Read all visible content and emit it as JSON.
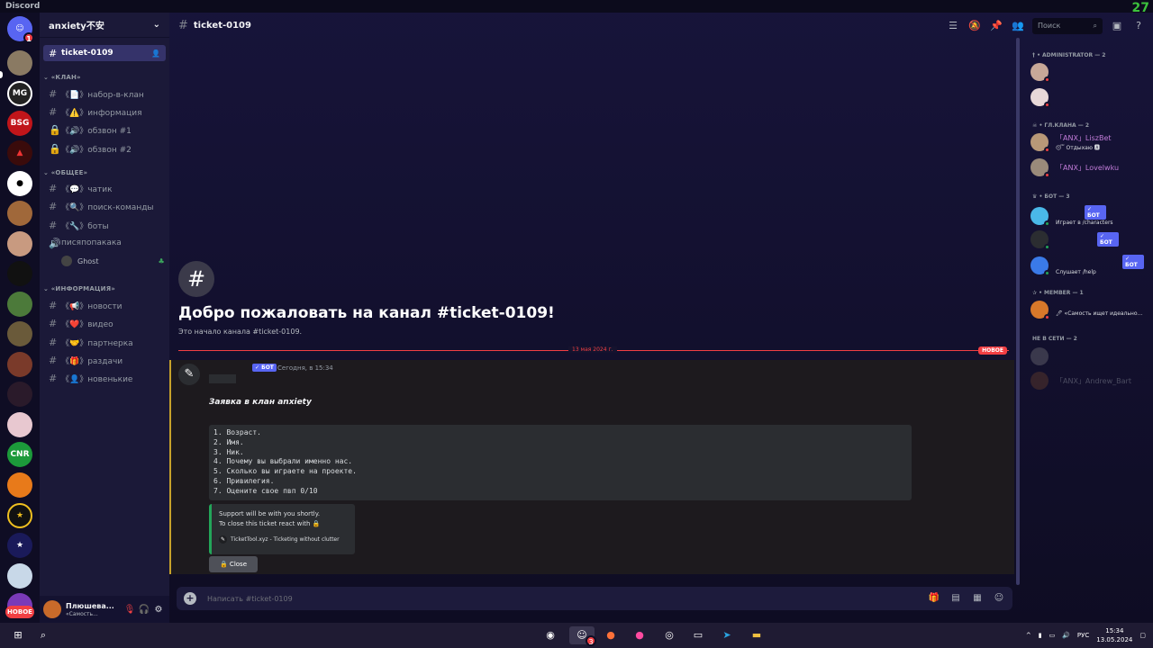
{
  "window": {
    "app_title": "Discord",
    "fps": "27"
  },
  "rail": {
    "home_badge": "1",
    "new_label": "НОВОЕ",
    "bsg_label": "BSG",
    "mg_label": "MG",
    "coin_label": "CNR"
  },
  "guild": {
    "name": "anxiety不安"
  },
  "channels": {
    "active": "ticket-0109",
    "cat_clan": "«КЛАН»",
    "nabor": "《📄》набор-в-клан",
    "info": "《⚠️》информация",
    "review1": "《🔊》обзвон #1",
    "review2": "《🔊》обзвон #2",
    "cat_general": "«ОБЩЕЕ»",
    "chat": "《💬》чатик",
    "search_team": "《🔍》поиск-команды",
    "bots": "《🔧》боты",
    "voice": "писяпопакака",
    "voice_user": "Ghost",
    "cat_info": "«ИНФОРМАЦИЯ»",
    "news": "《📢》новости",
    "video": "《❤️》видео",
    "partners": "《🤝》партнерка",
    "giveaways": "《🎁》раздачи",
    "newbies": "《👤》новенькие"
  },
  "user": {
    "name": "Плюшева...",
    "status": "«Самость..."
  },
  "header": {
    "channel": "ticket-0109",
    "search_placeholder": "Поиск"
  },
  "welcome": {
    "title": "Добро пожаловать на канал #ticket-0109!",
    "subtitle": "Это начало канала #ticket-0109."
  },
  "divider": {
    "date": "13 мая 2024 г.",
    "new_label": "НОВОЕ"
  },
  "message": {
    "bot_tag": "✓ БОТ",
    "time": "Сегодня, в 15:34",
    "title": "Заявка в клан anxiety",
    "lines": [
      "1. Возраст.",
      "2. Имя.",
      "3. Ник.",
      "4. Почему вы выбрали именно нас.",
      "5. Сколько вы играете на проекте.",
      "6. Привилегия.",
      "7. Оцените свое пвп 0/10"
    ],
    "embed_line1": "Support will be with you shortly.",
    "embed_line2": "To close this ticket react with 🔒",
    "embed_footer": "TicketTool.xyz - Ticketing without clutter",
    "close_button": "🔒 Close"
  },
  "composer": {
    "placeholder": "Написать #ticket-0109"
  },
  "members": {
    "admin_header": "† • ADMINISTRATOR — 2",
    "leader_header": "☠ • ГЛ.КЛАНА — 2",
    "leader1_name": "「ANX」LiszBet",
    "leader1_activity": "😴 Отдыхаю 🅰",
    "leader2_name": "「ANX」Lovelwku",
    "bot_header": "♛ • БОТ — 3",
    "bot1_activity": "Играет в /characters",
    "bot3_activity": "Слушает /help",
    "bot_tag": "✓ БОТ",
    "member_header": "✰ • MEMBER — 1",
    "member1_activity": "🖊 «Самость ищет идеально...",
    "offline_header": "НЕ В СЕТИ — 2",
    "offline2_name": "「ANX」Andrew_Bart"
  },
  "taskbar": {
    "lang": "РУС",
    "time": "15:34",
    "date": "13.05.2024",
    "discord_badge": "3"
  }
}
